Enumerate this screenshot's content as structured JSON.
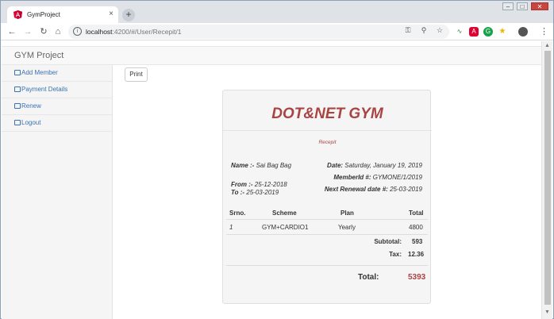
{
  "browser": {
    "tab_title": "GymProject",
    "tab_close": "×",
    "new_tab": "+",
    "url_host": "localhost",
    "url_path": ":4200/#/User/Recepit/1",
    "win_minimize": "–",
    "win_maximize": "□",
    "win_close": "✕"
  },
  "app": {
    "brand": "GYM Project",
    "sidebar": [
      {
        "label": "Add Member"
      },
      {
        "label": "Payment Details"
      },
      {
        "label": "Renew"
      },
      {
        "label": "Logout"
      }
    ],
    "print_label": "Print"
  },
  "receipt": {
    "title": "DOT&NET GYM",
    "subtitle": "Recepit",
    "name_label": "Name :-",
    "name": "Sai Bag Bag",
    "date_label": "Date:",
    "date": "Saturday, January 19, 2019",
    "memberid_label": "MemberId #:",
    "memberid": "GYMONE/1/2019",
    "from_label": "From :-",
    "from": "25-12-2018",
    "to_label": "To :-",
    "to": "25-03-2019",
    "renewal_label": "Next Renewal date #:",
    "renewal": "25-03-2019",
    "columns": [
      "Srno.",
      "Scheme",
      "Plan",
      "Total"
    ],
    "row": {
      "srno": "1",
      "scheme": "GYM+CARDIO1",
      "plan": "Yearly",
      "total": "4800"
    },
    "subtotal_label": "Subtotal:",
    "subtotal": "593",
    "tax_label": "Tax:",
    "tax": "12.36",
    "total_label": "Total:",
    "total": "5393"
  },
  "colors": {
    "accent": "#a94442",
    "link": "#3a72b0"
  }
}
